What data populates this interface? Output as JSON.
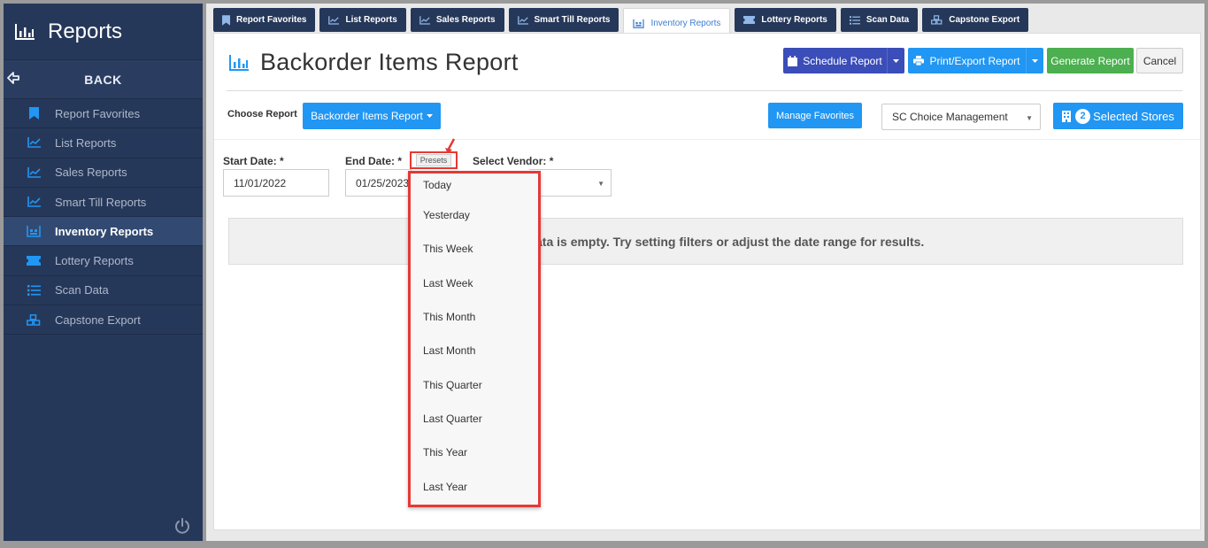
{
  "sidebar": {
    "title": "Reports",
    "back_label": "BACK",
    "items": [
      {
        "label": "Report Favorites",
        "icon": "bookmark-icon"
      },
      {
        "label": "List Reports",
        "icon": "line-chart-icon"
      },
      {
        "label": "Sales Reports",
        "icon": "line-chart-icon"
      },
      {
        "label": "Smart Till Reports",
        "icon": "line-chart-icon"
      },
      {
        "label": "Inventory Reports",
        "icon": "warehouse-icon",
        "active": true
      },
      {
        "label": "Lottery Reports",
        "icon": "ticket-icon"
      },
      {
        "label": "Scan Data",
        "icon": "list-icon"
      },
      {
        "label": "Capstone Export",
        "icon": "boxes-icon"
      }
    ]
  },
  "tabs": [
    {
      "label": "Report Favorites"
    },
    {
      "label": "List Reports"
    },
    {
      "label": "Sales Reports"
    },
    {
      "label": "Smart Till Reports"
    },
    {
      "label": "Inventory Reports",
      "active": true
    },
    {
      "label": "Lottery Reports"
    },
    {
      "label": "Scan Data"
    },
    {
      "label": "Capstone Export"
    }
  ],
  "header": {
    "title": "Backorder Items Report",
    "schedule_label": "Schedule Report",
    "print_label": "Print/Export Report",
    "generate_label": "Generate Report",
    "cancel_label": "Cancel"
  },
  "toolbar": {
    "choose_label": "Choose Report",
    "report_button": "Backorder Items Report",
    "favorites_button": "Manage Favorites",
    "store_group": "SC Choice Management",
    "selected_count": "2",
    "selected_label": "Selected Stores"
  },
  "filters": {
    "start_label": "Start Date: *",
    "start_value": "11/01/2022",
    "end_label": "End Date: *",
    "end_value": "01/25/2023",
    "presets_label": "Presets",
    "vendor_label": "Select Vendor: *"
  },
  "empty_message": "ata is empty. Try setting filters or adjust the date range for results.",
  "presets": [
    "Today",
    "Yesterday",
    "This Week",
    "Last Week",
    "This Month",
    "Last Month",
    "This Quarter",
    "Last Quarter",
    "This Year",
    "Last Year"
  ],
  "colors": {
    "sidebar_bg": "#263859",
    "primary": "#2196f3",
    "schedule": "#3b4db8",
    "generate": "#4caf50",
    "highlight": "#e53935"
  }
}
